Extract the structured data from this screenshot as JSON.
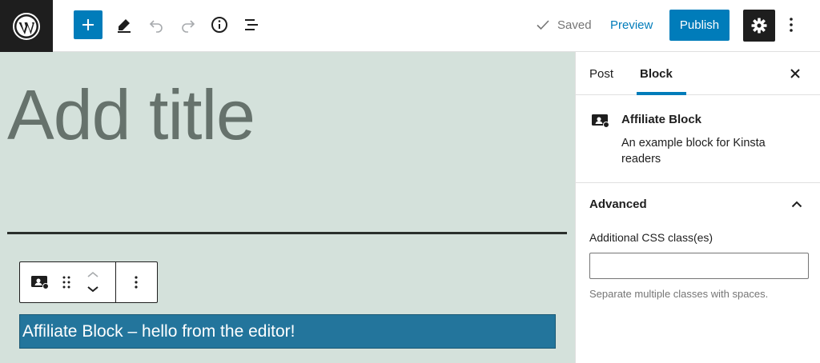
{
  "topbar": {
    "logo_icon": "wordpress-logo",
    "add_block_icon": "plus-icon",
    "tools_icon": "pencil-icon",
    "undo_icon": "undo-icon",
    "redo_icon": "redo-icon",
    "details_icon": "info-icon",
    "outline_icon": "list-view-icon",
    "saved_label": "Saved",
    "preview_label": "Preview",
    "publish_label": "Publish",
    "settings_icon": "gear-icon",
    "more_icon": "vertical-ellipsis-icon"
  },
  "editor": {
    "title_placeholder": "Add title",
    "block_text": "Affiliate Block – hello from the editor!",
    "block_toolbar": {
      "block_icon": "affiliate-block-icon",
      "drag_icon": "drag-handle-icon",
      "move_up_icon": "chevron-up-icon",
      "move_down_icon": "chevron-down-icon",
      "options_icon": "vertical-ellipsis-icon"
    }
  },
  "sidebar": {
    "tabs": [
      {
        "label": "Post",
        "active": false
      },
      {
        "label": "Block",
        "active": true
      }
    ],
    "close_icon": "close-icon",
    "block_card": {
      "icon": "affiliate-block-icon",
      "title": "Affiliate Block",
      "description": "An example block for Kinsta readers"
    },
    "advanced": {
      "header": "Advanced",
      "expanded": true,
      "css_label": "Additional CSS class(es)",
      "css_value": "",
      "css_help": "Separate multiple classes with spaces."
    }
  },
  "colors": {
    "accent": "#007cba",
    "canvas_bg": "#d4e1db",
    "block_bg": "#23759c",
    "dark": "#1e1e1e"
  }
}
